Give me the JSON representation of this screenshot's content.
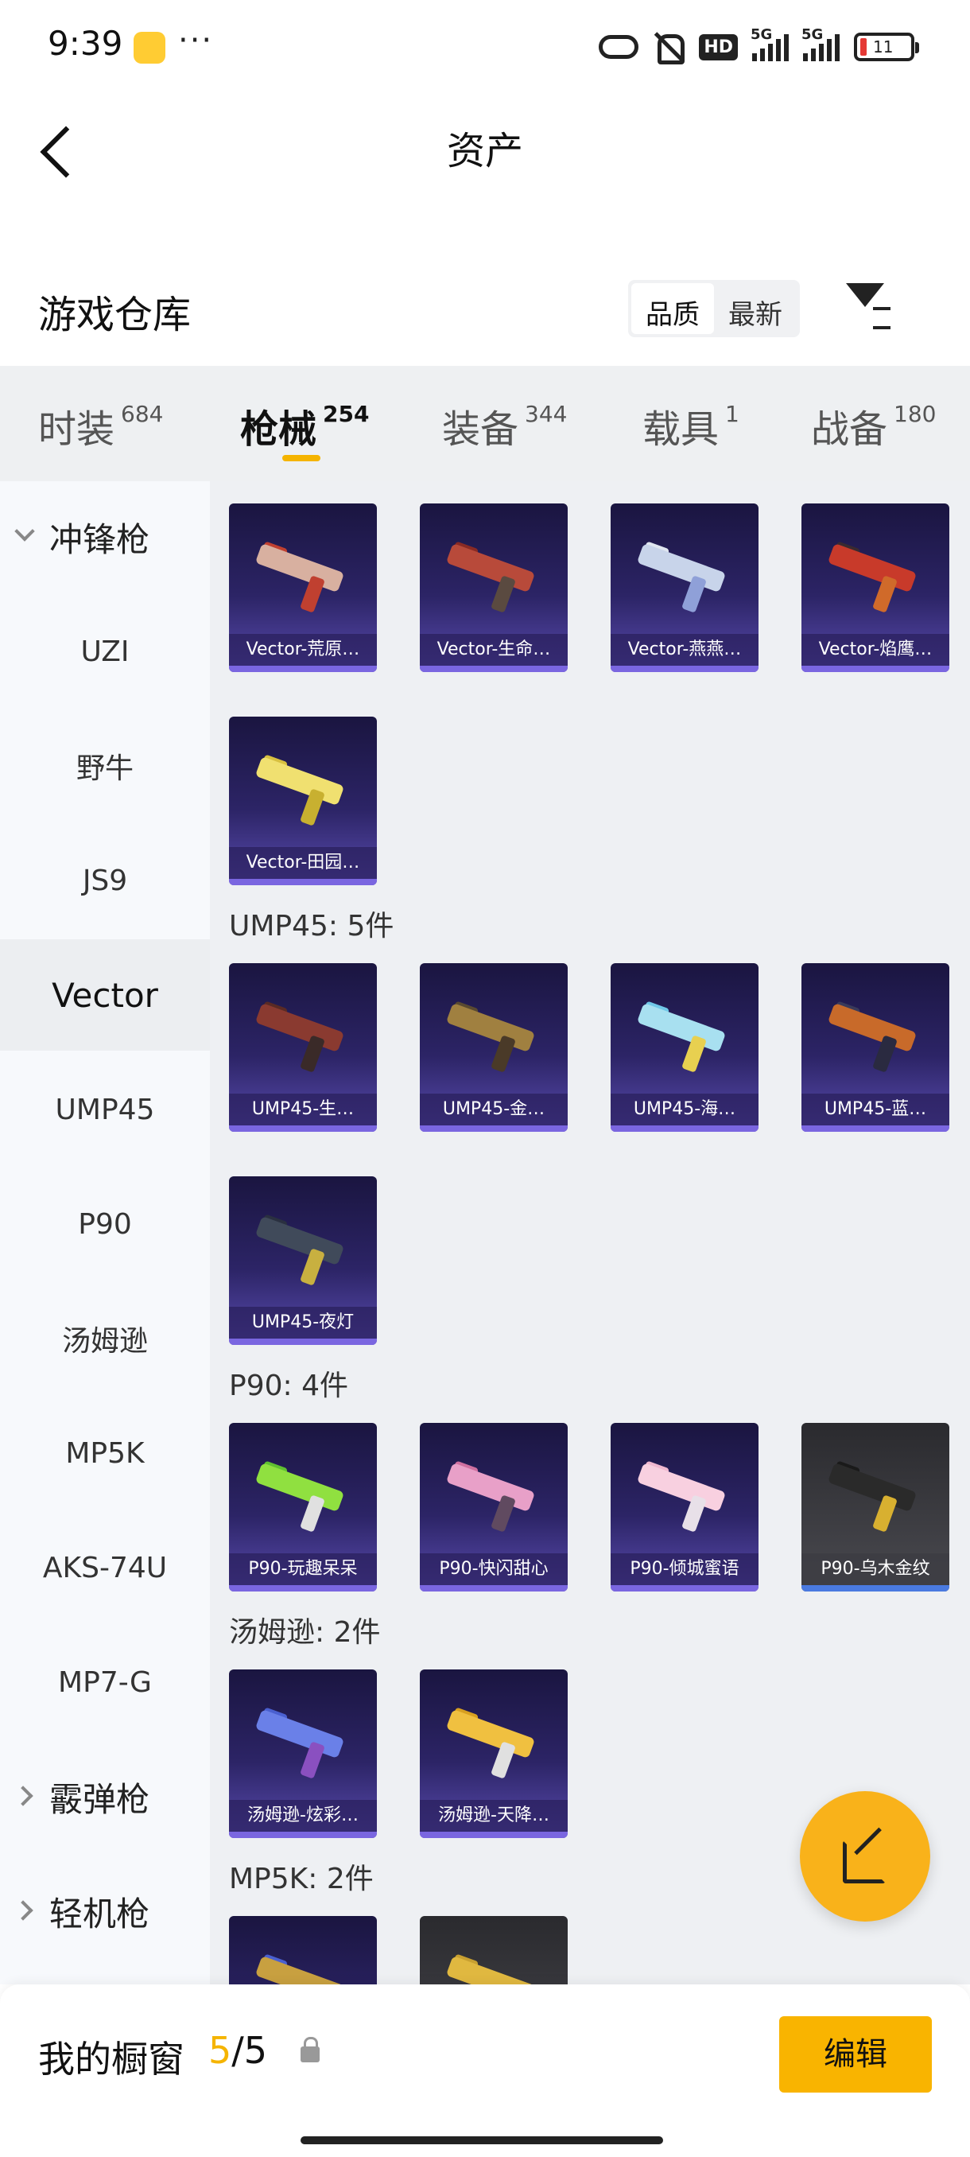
{
  "status_bar": {
    "time": "9:39",
    "dots": "···",
    "hd": "HD",
    "net1": "5G",
    "net2": "5G",
    "battery": "11"
  },
  "header": {
    "title": "资产"
  },
  "warehouse": {
    "title": "游戏仓库",
    "sort_quality": "品质",
    "sort_newest": "最新"
  },
  "tabs": [
    {
      "label": "时装",
      "count": "684"
    },
    {
      "label": "枪械",
      "count": "254"
    },
    {
      "label": "装备",
      "count": "344"
    },
    {
      "label": "载具",
      "count": "1"
    },
    {
      "label": "战备",
      "count": "180"
    }
  ],
  "sidebar": {
    "group_smg": "冲锋枪",
    "items": [
      "UZI",
      "野牛",
      "JS9",
      "Vector",
      "UMP45",
      "P90",
      "汤姆逊",
      "MP5K",
      "AKS-74U",
      "MP7-G"
    ],
    "group_shotgun": "霰弹枪",
    "group_lmg": "轻机枪"
  },
  "sections": {
    "vector_cards": [
      "Vector-荒原…",
      "Vector-生命…",
      "Vector-燕燕…",
      "Vector-焰鹰…",
      "Vector-田园…"
    ],
    "ump45_title": "UMP45: 5件",
    "ump45_cards": [
      "UMP45-生…",
      "UMP45-金…",
      "UMP45-海…",
      "UMP45-蓝…",
      "UMP45-夜灯"
    ],
    "p90_title": "P90: 4件",
    "p90_cards": [
      "P90-玩趣呆呆",
      "P90-快闪甜心",
      "P90-倾城蜜语",
      "P90-乌木金纹"
    ],
    "thompson_title": "汤姆逊: 2件",
    "thompson_cards": [
      "汤姆逊-炫彩…",
      "汤姆逊-天降…"
    ],
    "mp5k_title": "MP5K: 2件"
  },
  "bottom": {
    "label": "我的橱窗",
    "current": "5",
    "sep_total": "/5",
    "edit": "编辑"
  },
  "colors": {
    "accent": "#f9b400",
    "card_purple": "#2c2466",
    "card_bar": "#7a66e0"
  }
}
